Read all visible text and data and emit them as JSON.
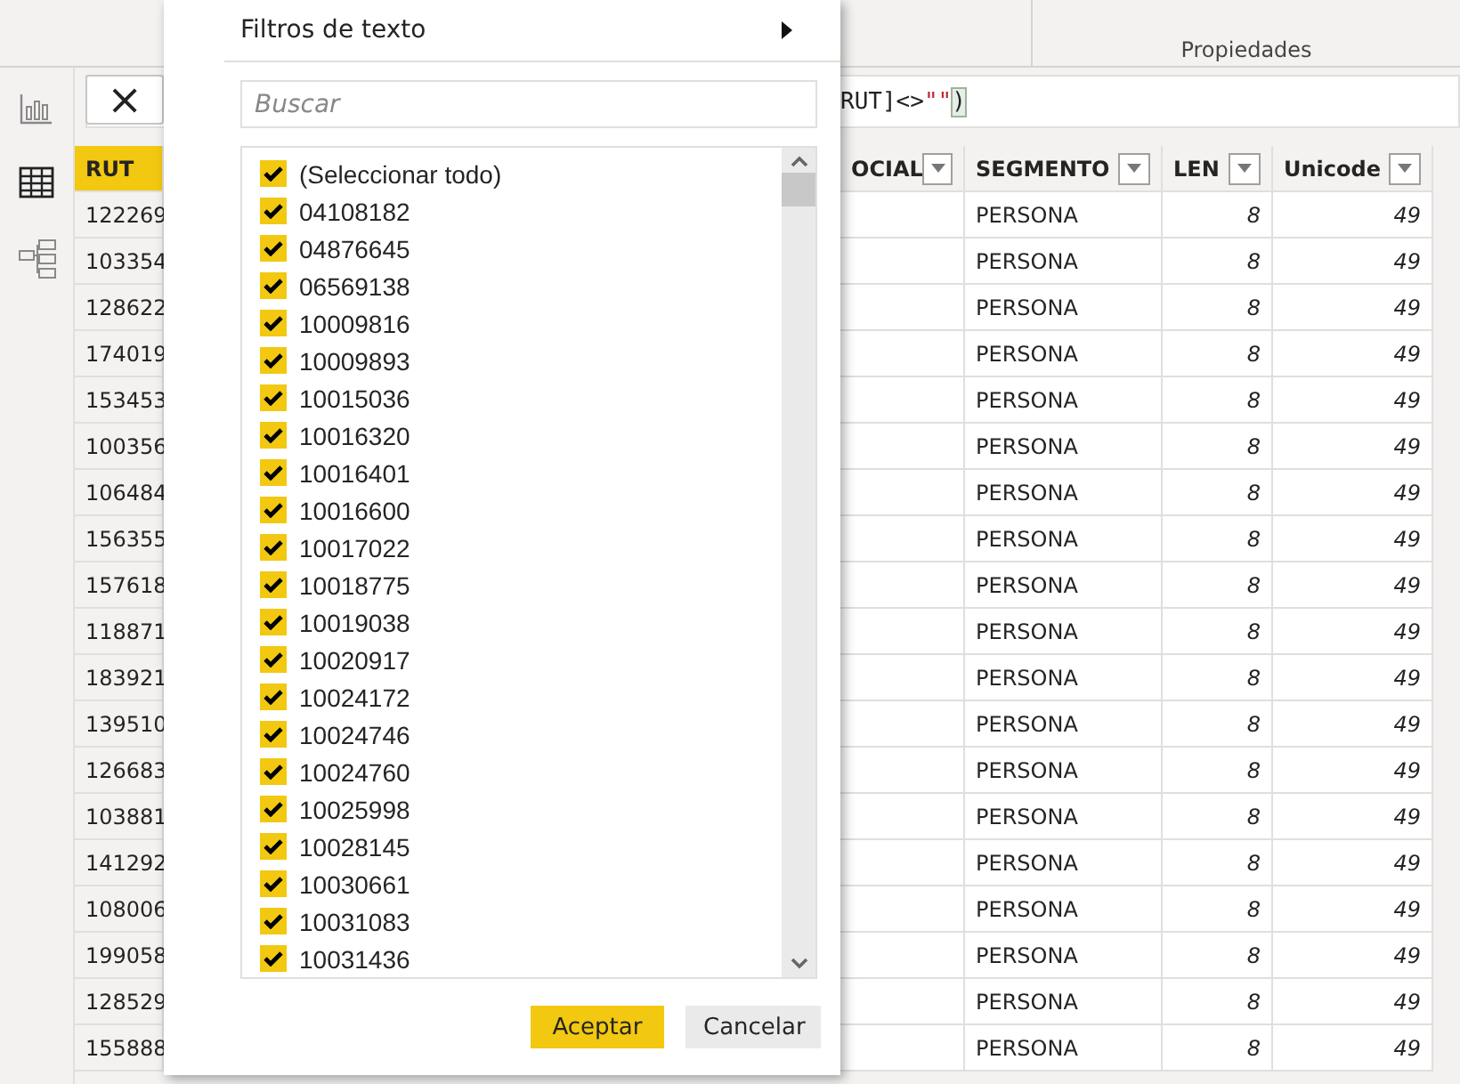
{
  "ribbon": {
    "group_label": "Propiedades"
  },
  "rail": [
    {
      "kind": "report",
      "selected": false
    },
    {
      "kind": "data",
      "selected": true
    },
    {
      "kind": "model",
      "selected": false
    }
  ],
  "formula_bar": {
    "cancel_icon": "×",
    "segments": [
      {
        "kind": "code",
        "text": "RUT]<>"
      },
      {
        "kind": "string",
        "text": "\"\""
      },
      {
        "kind": "bracket",
        "text": ")"
      }
    ]
  },
  "table": {
    "columns": [
      {
        "label": "RUT",
        "kind": "text",
        "selected": true
      },
      {
        "label": "OCIAL",
        "kind": "text",
        "selected": false
      },
      {
        "label": "SEGMENTO",
        "kind": "text",
        "selected": false
      },
      {
        "label": "LEN",
        "kind": "number",
        "selected": false
      },
      {
        "label": "Unicode",
        "kind": "number",
        "selected": false
      }
    ],
    "rows": [
      [
        "122269",
        null,
        "PERSONA",
        "8",
        "49"
      ],
      [
        "103354",
        null,
        "PERSONA",
        "8",
        "49"
      ],
      [
        "128622",
        null,
        "PERSONA",
        "8",
        "49"
      ],
      [
        "174019",
        null,
        "PERSONA",
        "8",
        "49"
      ],
      [
        "153453",
        null,
        "PERSONA",
        "8",
        "49"
      ],
      [
        "100356",
        null,
        "PERSONA",
        "8",
        "49"
      ],
      [
        "106484",
        null,
        "PERSONA",
        "8",
        "49"
      ],
      [
        "156355",
        null,
        "PERSONA",
        "8",
        "49"
      ],
      [
        "157618",
        null,
        "PERSONA",
        "8",
        "49"
      ],
      [
        "118871",
        null,
        "PERSONA",
        "8",
        "49"
      ],
      [
        "183921",
        null,
        "PERSONA",
        "8",
        "49"
      ],
      [
        "139510",
        null,
        "PERSONA",
        "8",
        "49"
      ],
      [
        "126683",
        null,
        "PERSONA",
        "8",
        "49"
      ],
      [
        "103881",
        null,
        "PERSONA",
        "8",
        "49"
      ],
      [
        "141292",
        null,
        "PERSONA",
        "8",
        "49"
      ],
      [
        "108006",
        null,
        "PERSONA",
        "8",
        "49"
      ],
      [
        "199058",
        null,
        "PERSONA",
        "8",
        "49"
      ],
      [
        "128529",
        null,
        "PERSONA",
        "8",
        "49"
      ],
      [
        "155888",
        null,
        "PERSONA",
        "8",
        "49"
      ]
    ]
  },
  "filter_menu": {
    "text_filters": "Filtros de texto",
    "search": {
      "placeholder": "Buscar"
    },
    "items": [
      {
        "label": "(Seleccionar todo)",
        "checked": true
      },
      {
        "label": "04108182",
        "checked": true
      },
      {
        "label": "04876645",
        "checked": true
      },
      {
        "label": "06569138",
        "checked": true
      },
      {
        "label": "10009816",
        "checked": true
      },
      {
        "label": "10009893",
        "checked": true
      },
      {
        "label": "10015036",
        "checked": true
      },
      {
        "label": "10016320",
        "checked": true
      },
      {
        "label": "10016401",
        "checked": true
      },
      {
        "label": "10016600",
        "checked": true
      },
      {
        "label": "10017022",
        "checked": true
      },
      {
        "label": "10018775",
        "checked": true
      },
      {
        "label": "10019038",
        "checked": true
      },
      {
        "label": "10020917",
        "checked": true
      },
      {
        "label": "10024172",
        "checked": true
      },
      {
        "label": "10024746",
        "checked": true
      },
      {
        "label": "10024760",
        "checked": true
      },
      {
        "label": "10025998",
        "checked": true
      },
      {
        "label": "10028145",
        "checked": true
      },
      {
        "label": "10030661",
        "checked": true
      },
      {
        "label": "10031083",
        "checked": true
      },
      {
        "label": "10031436",
        "checked": true
      }
    ],
    "buttons": [
      {
        "kind": "primary",
        "label": "Aceptar"
      },
      {
        "kind": "secondary",
        "label": "Cancelar"
      }
    ]
  }
}
